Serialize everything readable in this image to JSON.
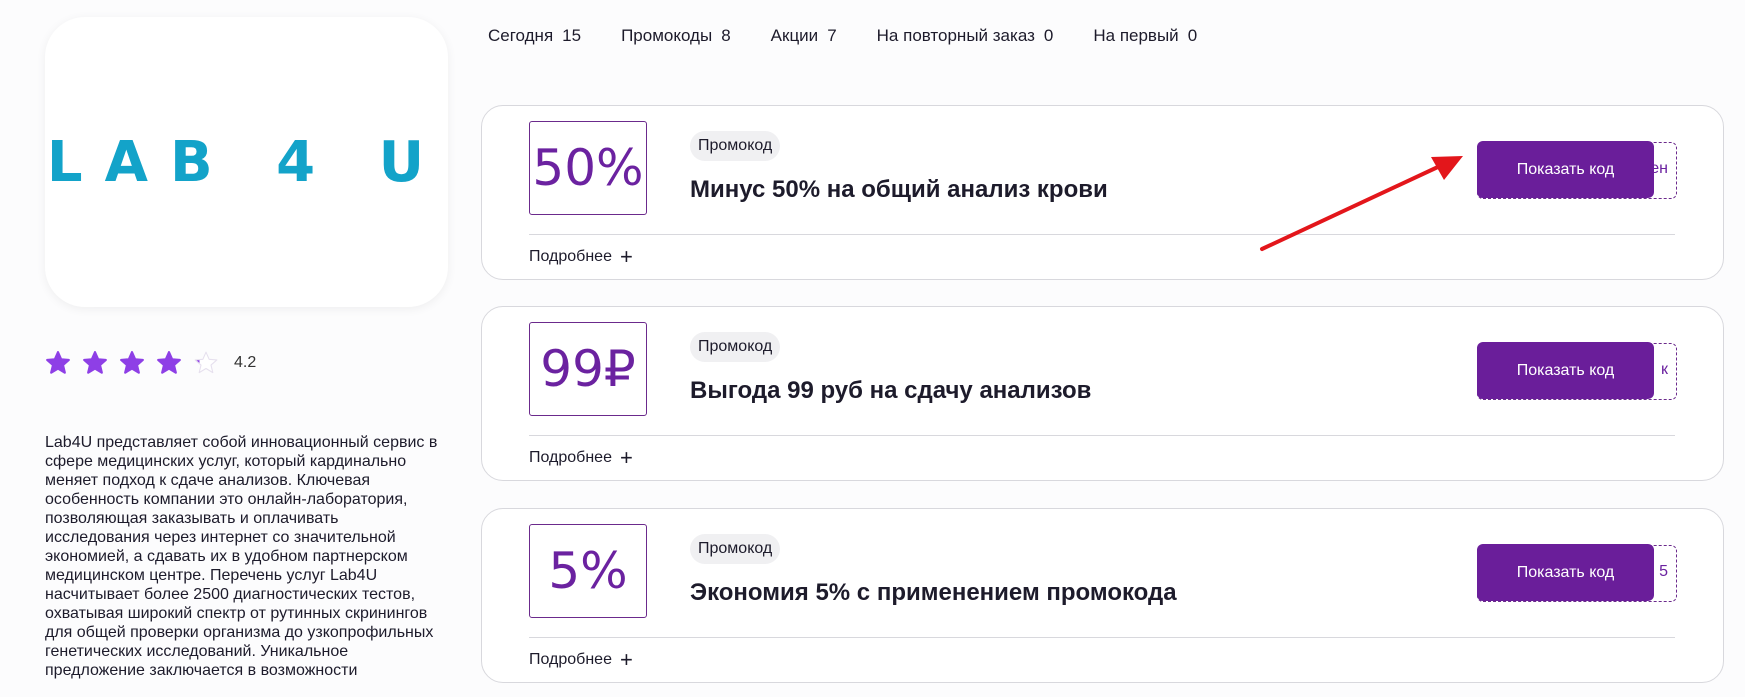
{
  "logo": {
    "text": "LAB 4 U"
  },
  "rating": {
    "value": "4.2",
    "stars_filled": 4,
    "stars_total": 5
  },
  "description": "Lab4U представляет собой инновационный сервис в сфере медицинских услуг, который кардинально меняет подход к сдаче анализов. Ключевая особенность компании это онлайн-лаборатория, позволяющая заказывать и оплачивать исследования через интернет со значительной экономией, а сдавать их в удобном партнерском медицинском центре. Перечень услуг Lab4U насчитывает более 2500 диагностических тестов, охватывая широкий спектр от рутинных скринингов для общей проверки организма до узкопрофильных генетических исследований. Уникальное предложение заключается в возможности",
  "tabs": [
    {
      "label": "Сегодня",
      "count": "15"
    },
    {
      "label": "Промокоды",
      "count": "8"
    },
    {
      "label": "Акции",
      "count": "7"
    },
    {
      "label": "На повторный заказ",
      "count": "0"
    },
    {
      "label": "На первый",
      "count": "0"
    }
  ],
  "coupons": [
    {
      "badge": "50%",
      "type": "Промокод",
      "title": "Минус 50% на общий анализ крови",
      "button": "Показать код",
      "code_peek": "ен",
      "more": "Подробнее"
    },
    {
      "badge": "99₽",
      "type": "Промокод",
      "title": "Выгода 99 руб на сдачу анализов",
      "button": "Показать код",
      "code_peek": "к",
      "more": "Подробнее"
    },
    {
      "badge": "5%",
      "type": "Промокод",
      "title": "Экономия 5% с применением промокода",
      "button": "Показать код",
      "code_peek": "5",
      "more": "Подробнее"
    }
  ],
  "colors": {
    "accent": "#6a1e9a",
    "logo": "#13a3c9",
    "star": "#8e3fe6",
    "annotation_arrow": "#e3161b"
  }
}
